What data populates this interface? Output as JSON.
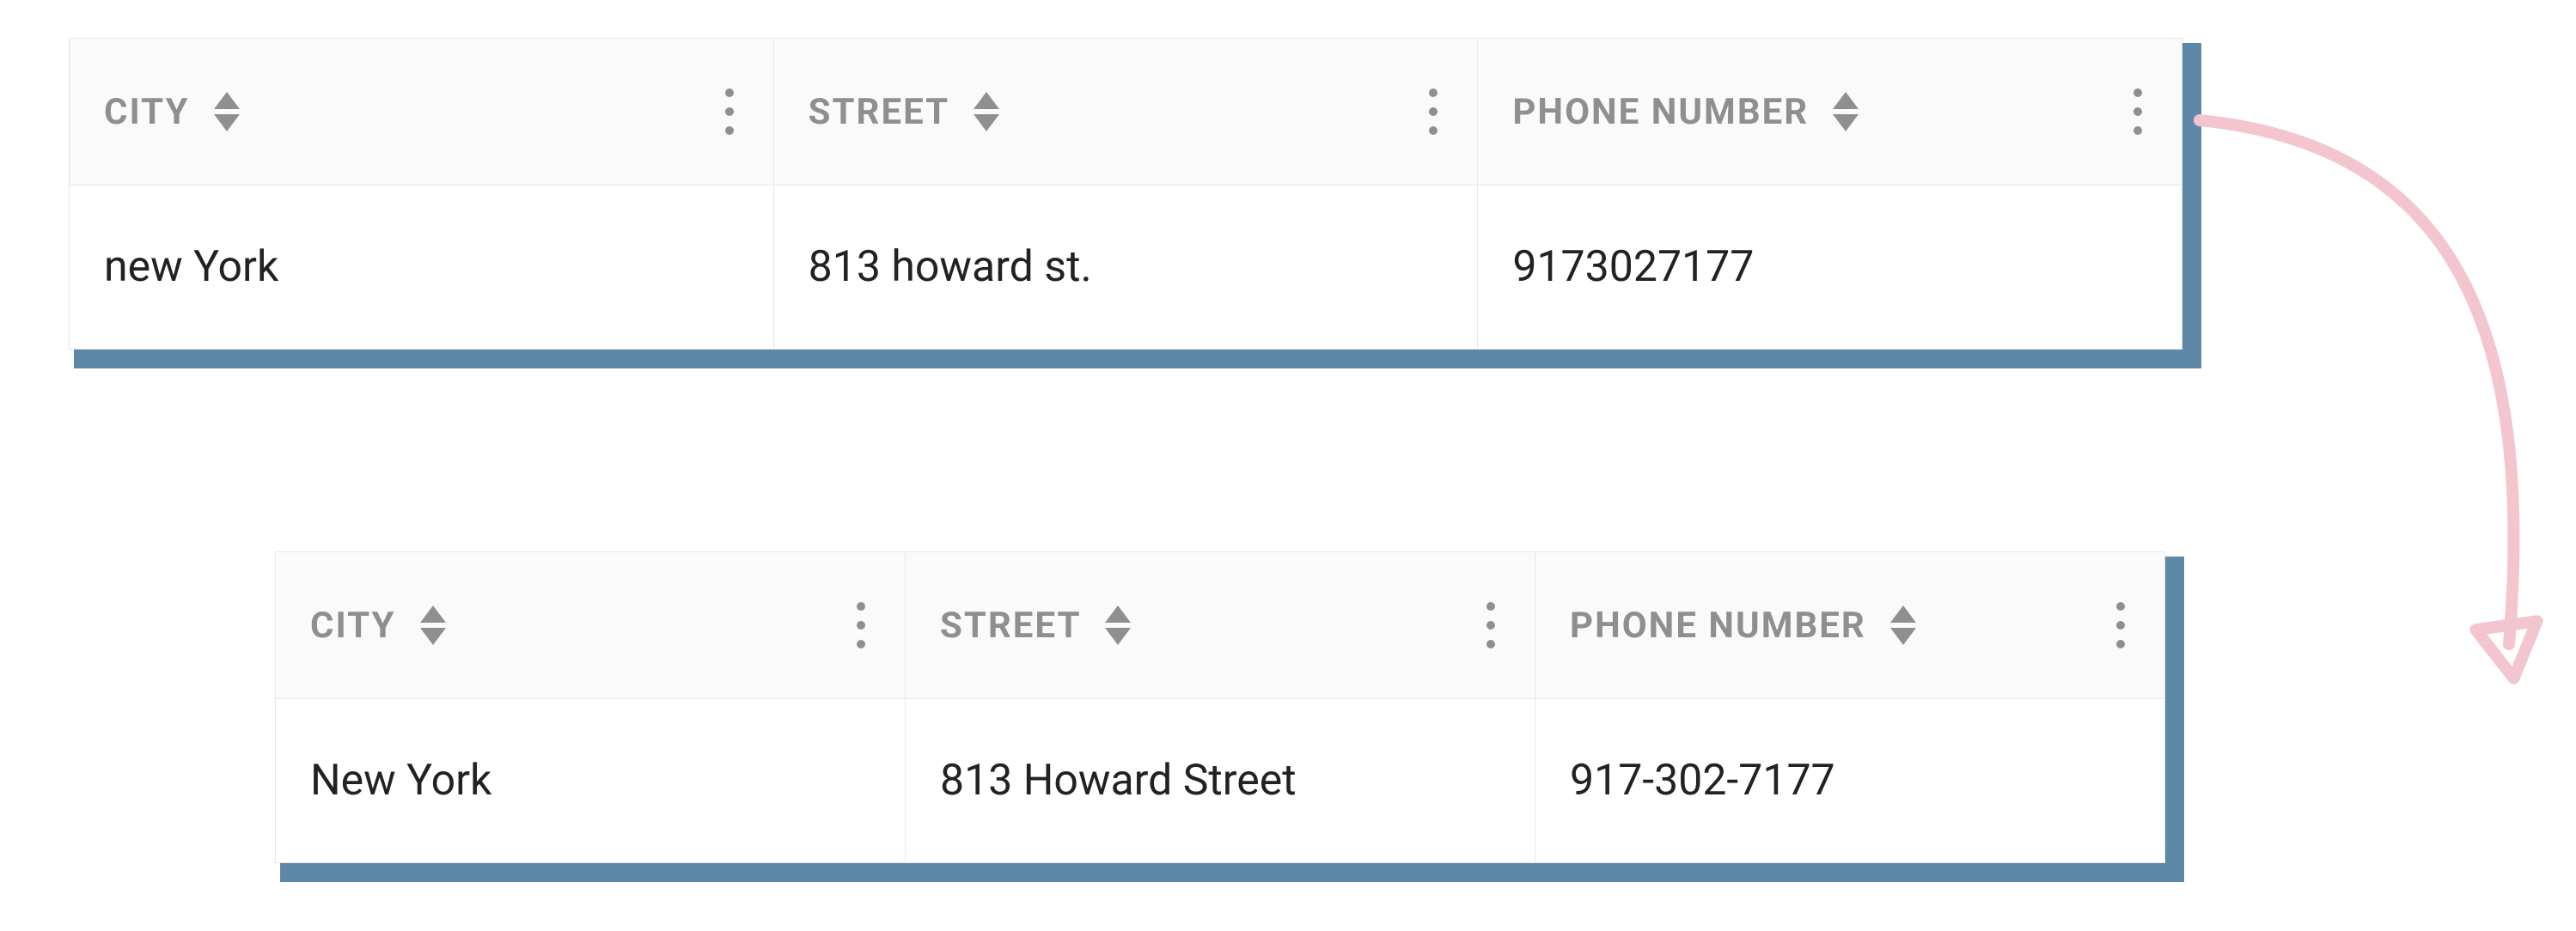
{
  "columns": {
    "city": {
      "label": "CITY"
    },
    "street": {
      "label": "STREET"
    },
    "phone": {
      "label": "PHONE NUMBER"
    }
  },
  "before": {
    "city": "new York",
    "street": "813 howard st.",
    "phone": "9173027177"
  },
  "after": {
    "city": "New York",
    "street": "813 Howard Street",
    "phone": "917-302-7177"
  },
  "arrow_color": "#f3c6cf"
}
